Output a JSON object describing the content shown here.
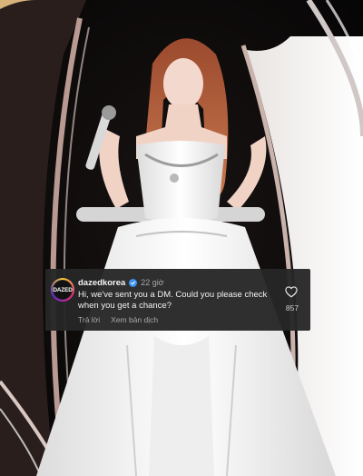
{
  "comment": {
    "avatar_text": "DAZED",
    "username": "dazedkorea",
    "timestamp": "22 giờ",
    "text": "Hi, we've sent you a DM. Could you please check when you get a chance?",
    "reply_label": "Trả lời",
    "translate_label": "Xem bản dịch",
    "like_count": "857"
  },
  "icons": {
    "verified": "verified-badge-icon",
    "like": "heart-icon"
  },
  "colors": {
    "card_bg": "#262628",
    "verified_blue": "#3b95f3",
    "secondary_text": "#a8a8a8"
  }
}
